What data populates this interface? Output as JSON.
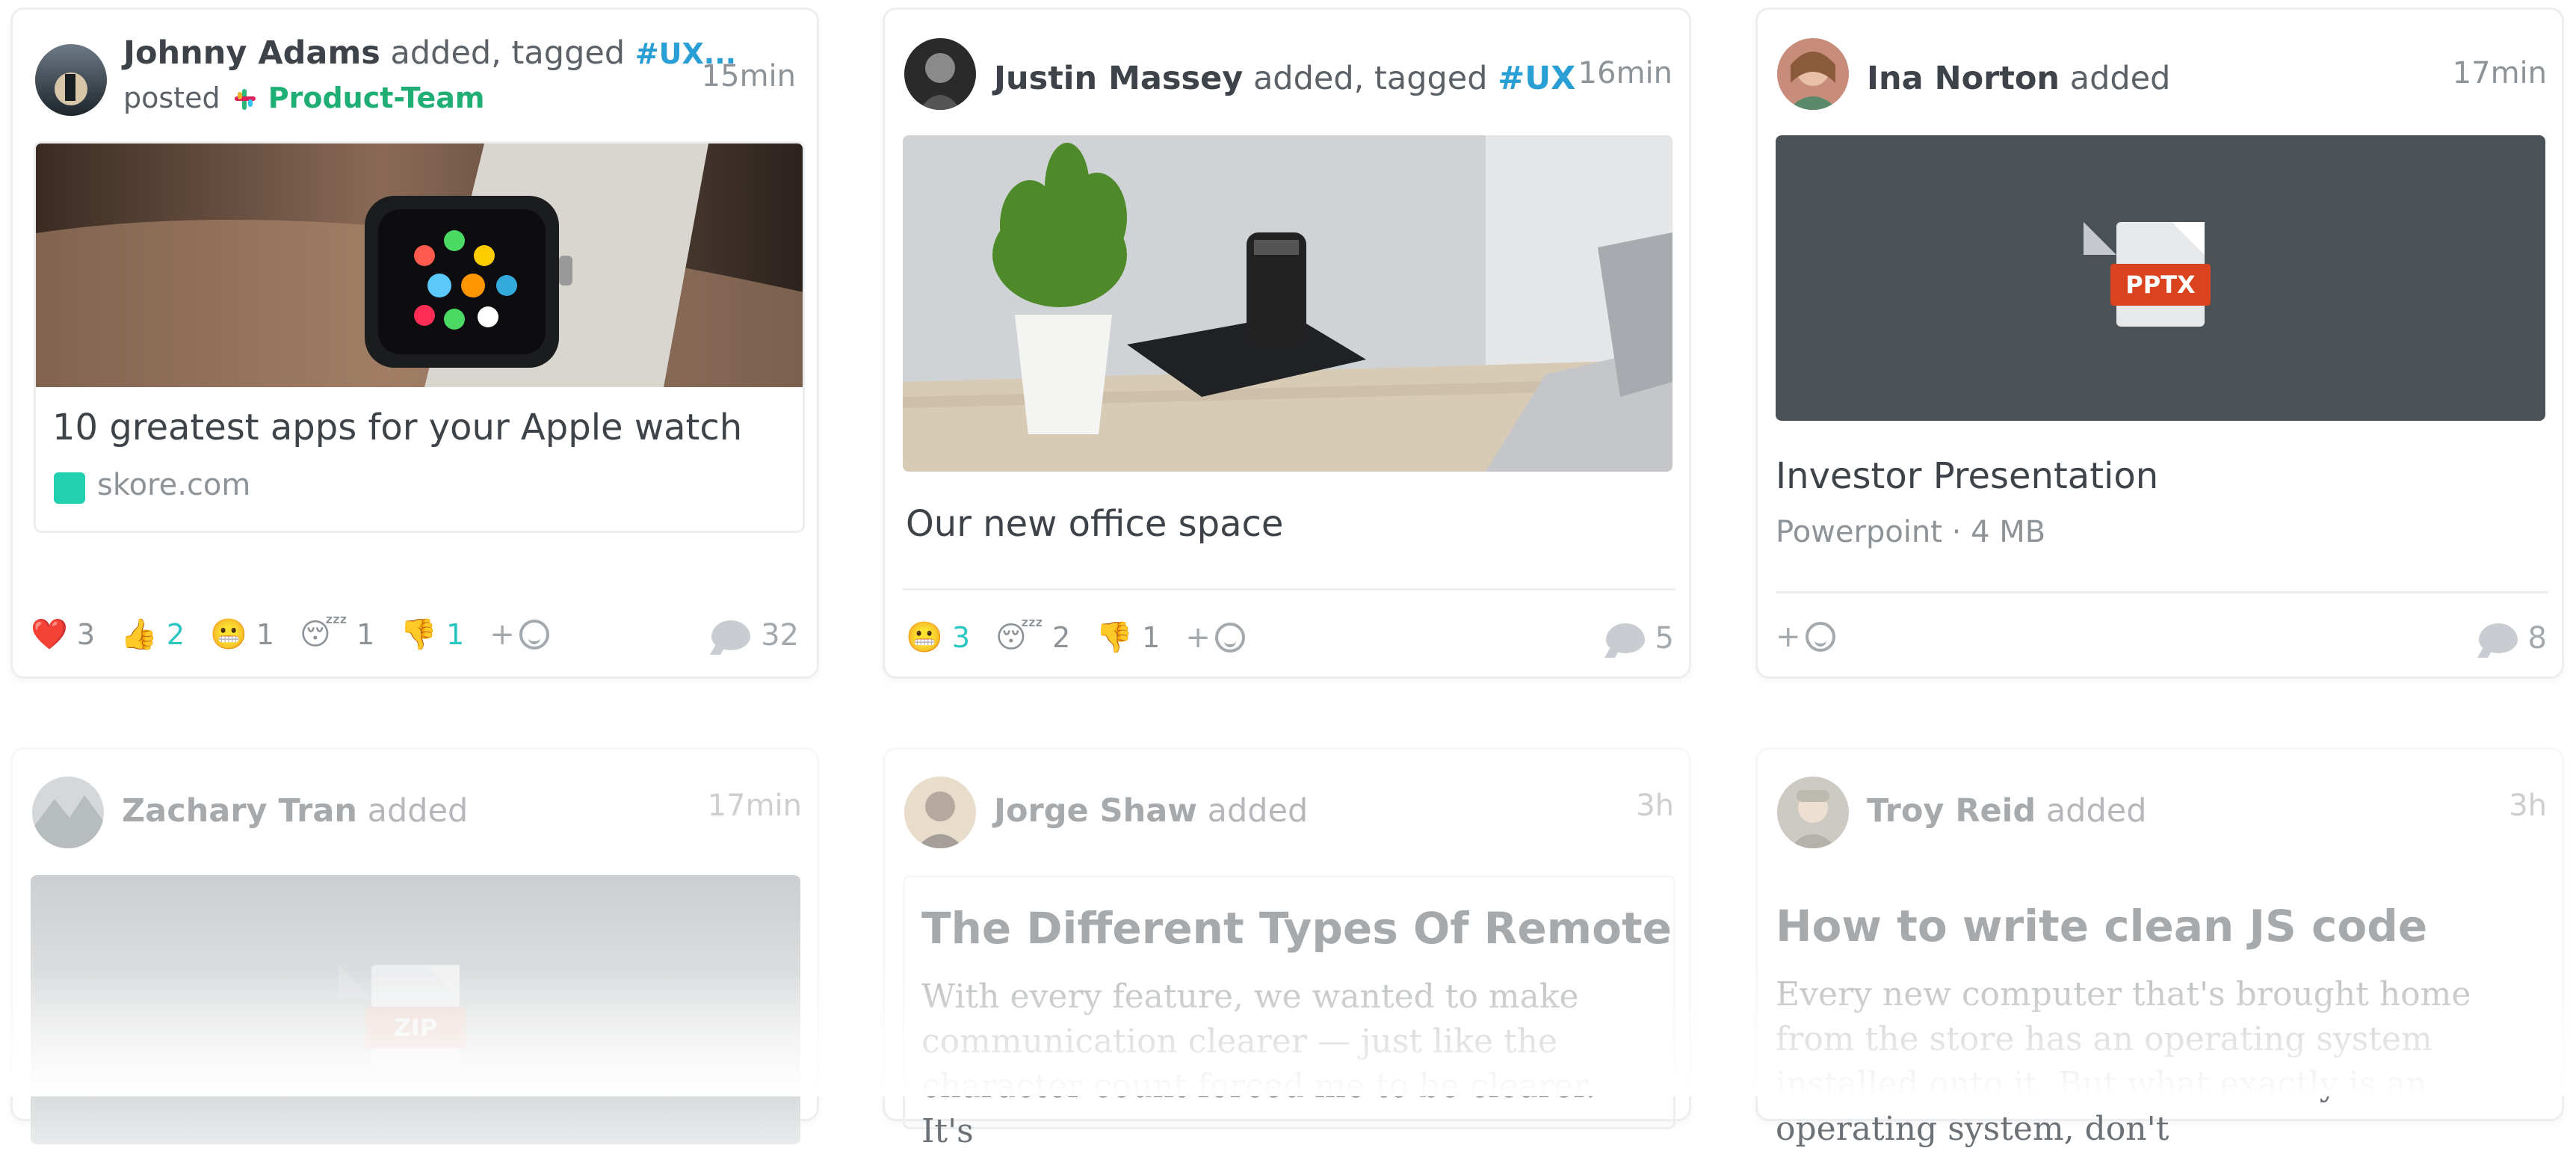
{
  "cards": [
    {
      "author": "Johnny Adams",
      "action": "added, tagged",
      "tag": "#UX...",
      "posted_label": "posted",
      "team": "Product-Team",
      "time": "15min",
      "link_title": "10 greatest apps for your Apple watch",
      "link_domain": "skore.com",
      "reactions": [
        {
          "emoji": "❤️",
          "count": "3",
          "highlight": false
        },
        {
          "emoji": "👍",
          "count": "2",
          "highlight": true
        },
        {
          "emoji": "😬",
          "count": "1",
          "highlight": false
        },
        {
          "emoji": "😴",
          "count": "1",
          "highlight": false
        },
        {
          "emoji": "👎",
          "count": "1",
          "highlight": true
        }
      ],
      "add_reaction": "+",
      "comments": "32"
    },
    {
      "author": "Justin Massey",
      "action": "added, tagged",
      "tag": "#UX",
      "time": "16min",
      "title": "Our new office space",
      "reactions": [
        {
          "emoji": "😬",
          "count": "3",
          "highlight": true
        },
        {
          "emoji": "😴",
          "count": "2",
          "highlight": false
        },
        {
          "emoji": "👎",
          "count": "1",
          "highlight": false
        }
      ],
      "add_reaction": "+",
      "comments": "5"
    },
    {
      "author": "Ina Norton",
      "action": "added",
      "time": "17min",
      "file_type": "PPTX",
      "title": "Investor Presentation",
      "meta": "Powerpoint · 4 MB",
      "add_reaction": "+",
      "comments": "8"
    },
    {
      "author": "Zachary Tran",
      "action": "added",
      "time": "17min",
      "file_type": "ZIP"
    },
    {
      "author": "Jorge Shaw",
      "action": "added",
      "time": "3h",
      "title": "The Different Types Of Remote",
      "body": "With every feature, we wanted to make communication clearer — just like the character count forced me to be clearer. It's"
    },
    {
      "author": "Troy Reid",
      "action": "added",
      "time": "3h",
      "title": "How to write clean JS code",
      "body": "Every new computer that's brought home from the store has an operating system installed onto it. But what exactly is an operating system, don't"
    }
  ],
  "colors": {
    "tag": "#2a9fd6",
    "team": "#1fae74",
    "highlight": "#2bc6c0",
    "pptx": "#d9441e",
    "file_bg": "#4a5157"
  }
}
